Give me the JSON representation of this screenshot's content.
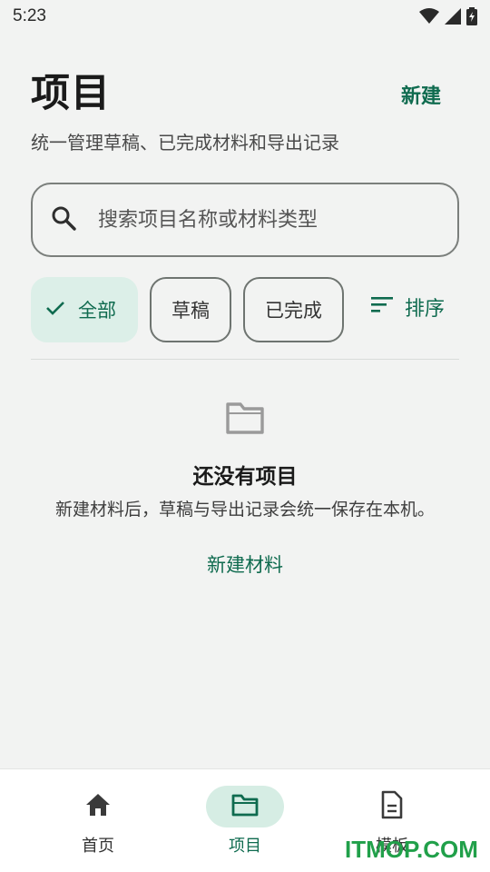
{
  "status_bar": {
    "time": "5:23",
    "icons": [
      "wifi-icon",
      "signal-icon",
      "battery-charging-icon"
    ]
  },
  "header": {
    "title": "项目",
    "new_label": "新建",
    "subtitle": "统一管理草稿、已完成材料和导出记录"
  },
  "search": {
    "placeholder": "搜索项目名称或材料类型",
    "value": ""
  },
  "filters": {
    "chips": [
      {
        "label": "全部",
        "selected": true
      },
      {
        "label": "草稿",
        "selected": false
      },
      {
        "label": "已完成",
        "selected": false
      }
    ],
    "sort_label": "排序"
  },
  "empty_state": {
    "icon": "folder-icon",
    "title": "还没有项目",
    "description": "新建材料后，草稿与导出记录会统一保存在本机。",
    "action_label": "新建材料"
  },
  "bottom_nav": {
    "items": [
      {
        "label": "首页",
        "icon": "home-icon",
        "active": false
      },
      {
        "label": "项目",
        "icon": "folder-icon",
        "active": true
      },
      {
        "label": "模板",
        "icon": "document-icon",
        "active": false
      }
    ]
  },
  "watermark": "ITMOP.COM",
  "colors": {
    "accent": "#0f6b4f",
    "chip_selected_bg": "#dcefe8",
    "background": "#f2f3f2",
    "watermark": "#21a04a"
  }
}
